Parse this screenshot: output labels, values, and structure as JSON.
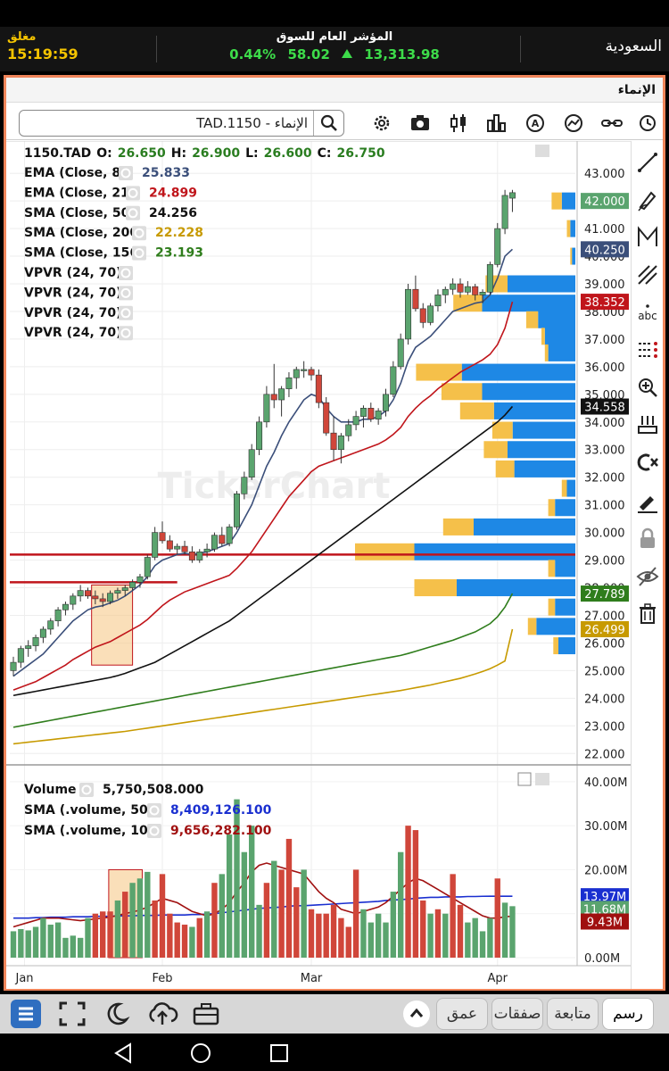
{
  "market": {
    "status_label": "مغلق",
    "time": "15:19:59",
    "index_title": "المؤشر العام للسوق",
    "change_pct": "0.44%",
    "change_pts": "58.02",
    "index_value": "13,313.98",
    "country": "السعودية"
  },
  "panel": {
    "title": "الإنماء"
  },
  "search": {
    "value": "TAD.1150 - الإنماء"
  },
  "ohlc": {
    "symbol": "1150.TAD",
    "o_label": "O:",
    "o": "26.650",
    "h_label": "H:",
    "h": "26.900",
    "l_label": "L:",
    "l": "26.600",
    "c_label": "C:",
    "c": "26.750"
  },
  "indicators": [
    {
      "label": "EMA (Close, 8)",
      "value": "25.833",
      "color": "#3b4f7a"
    },
    {
      "label": "EMA (Close, 21)",
      "value": "24.899",
      "color": "#c0151b"
    },
    {
      "label": "SMA (Close, 50)",
      "value": "24.256",
      "color": "#111111"
    },
    {
      "label": "SMA (Close, 200)",
      "value": "22.228",
      "color": "#c79a00"
    },
    {
      "label": "SMA (Close, 156)",
      "value": "23.193",
      "color": "#2f7d1c"
    },
    {
      "label": "VPVR (24, 70)",
      "value": ""
    },
    {
      "label": "VPVR (24, 70)",
      "value": ""
    },
    {
      "label": "VPVR (24, 70)",
      "value": ""
    },
    {
      "label": "VPVR (24, 70)",
      "value": ""
    }
  ],
  "volume_panel": {
    "label": "Volume",
    "value": "5,750,508.000",
    "sma50_label": "SMA (.volume, 50)",
    "sma50_value": "8,409,126.100",
    "sma10_label": "SMA (.volume, 10)",
    "sma10_value": "9,656,282.100"
  },
  "price_badges": [
    {
      "text": "42.000",
      "color": "#5aa46e"
    },
    {
      "text": "40.250",
      "color": "#3b4f7a"
    },
    {
      "text": "38.352",
      "color": "#c0151b"
    },
    {
      "text": "34.558",
      "color": "#111111"
    },
    {
      "text": "27.789",
      "color": "#2f7d1c"
    },
    {
      "text": "26.499",
      "color": "#c79a00"
    }
  ],
  "volume_badges": [
    {
      "text": "13.97M",
      "color": "#1a2fd0"
    },
    {
      "text": "11.68M",
      "color": "#5aa46e"
    },
    {
      "text": "9.43M",
      "color": "#a01010"
    }
  ],
  "watermark": "TickerChart",
  "tabs": {
    "chart": "رسم",
    "watch": "متابعة",
    "trades": "صفقات",
    "depth": "عمق"
  },
  "chart_data": {
    "type": "candlestick",
    "y_ticks": [
      "43.000",
      "42.000",
      "41.000",
      "40.000",
      "39.000",
      "38.000",
      "37.000",
      "36.000",
      "35.000",
      "34.000",
      "33.000",
      "32.000",
      "31.000",
      "30.000",
      "29.000",
      "28.000",
      "27.000",
      "26.000",
      "25.000",
      "24.000",
      "23.000",
      "22.000"
    ],
    "ylim": [
      21.75,
      43.2
    ],
    "x_labels": [
      {
        "text": "Jan",
        "bar": 1.5
      },
      {
        "text": "Feb",
        "bar": 20
      },
      {
        "text": "Mar",
        "bar": 40
      },
      {
        "text": "Apr",
        "bar": 65
      }
    ],
    "candles": [
      [
        25.0,
        25.5,
        24.8,
        25.3
      ],
      [
        25.3,
        25.9,
        25.1,
        25.8
      ],
      [
        25.8,
        26.1,
        25.5,
        25.9
      ],
      [
        25.9,
        26.3,
        25.7,
        26.2
      ],
      [
        26.2,
        26.6,
        26.0,
        26.5
      ],
      [
        26.5,
        26.9,
        26.3,
        26.8
      ],
      [
        26.8,
        27.3,
        26.6,
        27.2
      ],
      [
        27.2,
        27.5,
        27.0,
        27.4
      ],
      [
        27.4,
        27.8,
        27.2,
        27.7
      ],
      [
        27.7,
        28.1,
        27.5,
        27.9
      ],
      [
        27.9,
        28.0,
        27.6,
        27.7
      ],
      [
        27.7,
        27.9,
        27.4,
        27.6
      ],
      [
        27.6,
        27.8,
        27.3,
        27.5
      ],
      [
        27.5,
        27.9,
        27.4,
        27.8
      ],
      [
        27.8,
        28.0,
        27.6,
        27.9
      ],
      [
        27.9,
        28.1,
        27.7,
        28.0
      ],
      [
        28.0,
        28.3,
        27.9,
        28.2
      ],
      [
        28.2,
        28.5,
        28.0,
        28.4
      ],
      [
        28.4,
        29.2,
        28.3,
        29.1
      ],
      [
        29.1,
        30.2,
        29.0,
        30.0
      ],
      [
        30.0,
        30.4,
        29.6,
        29.7
      ],
      [
        29.7,
        29.9,
        29.3,
        29.4
      ],
      [
        29.4,
        29.6,
        29.2,
        29.5
      ],
      [
        29.5,
        29.7,
        29.2,
        29.3
      ],
      [
        29.3,
        29.5,
        28.9,
        29.0
      ],
      [
        29.0,
        29.4,
        28.9,
        29.3
      ],
      [
        29.3,
        29.6,
        29.1,
        29.4
      ],
      [
        29.4,
        30.0,
        29.3,
        29.9
      ],
      [
        29.9,
        30.2,
        29.5,
        29.6
      ],
      [
        29.6,
        30.3,
        29.5,
        30.2
      ],
      [
        30.2,
        31.5,
        30.1,
        31.4
      ],
      [
        31.4,
        32.2,
        31.2,
        32.0
      ],
      [
        32.0,
        33.2,
        31.9,
        33.0
      ],
      [
        33.0,
        34.2,
        32.8,
        34.0
      ],
      [
        34.0,
        35.3,
        33.8,
        35.0
      ],
      [
        35.0,
        36.1,
        34.5,
        34.8
      ],
      [
        34.8,
        35.3,
        34.2,
        35.2
      ],
      [
        35.2,
        35.8,
        34.9,
        35.6
      ],
      [
        35.6,
        36.0,
        35.2,
        35.9
      ],
      [
        35.9,
        36.2,
        35.6,
        35.9
      ],
      [
        35.9,
        36.0,
        35.5,
        35.7
      ],
      [
        35.7,
        35.9,
        34.5,
        34.7
      ],
      [
        34.7,
        34.9,
        33.5,
        33.6
      ],
      [
        33.6,
        34.2,
        32.6,
        33.0
      ],
      [
        33.0,
        33.6,
        32.5,
        33.5
      ],
      [
        33.5,
        34.1,
        33.3,
        33.9
      ],
      [
        33.9,
        34.4,
        33.7,
        34.2
      ],
      [
        34.2,
        34.6,
        33.8,
        34.5
      ],
      [
        34.5,
        34.7,
        34.0,
        34.1
      ],
      [
        34.1,
        34.5,
        33.9,
        34.4
      ],
      [
        34.4,
        35.2,
        34.2,
        35.0
      ],
      [
        35.0,
        36.2,
        34.9,
        36.0
      ],
      [
        36.0,
        37.2,
        35.9,
        37.0
      ],
      [
        37.0,
        39.0,
        36.8,
        38.8
      ],
      [
        38.8,
        39.3,
        38.0,
        38.1
      ],
      [
        38.1,
        38.3,
        37.4,
        37.6
      ],
      [
        37.6,
        38.3,
        37.5,
        38.2
      ],
      [
        38.2,
        38.8,
        38.0,
        38.6
      ],
      [
        38.6,
        38.9,
        38.3,
        38.8
      ],
      [
        38.8,
        39.2,
        38.6,
        39.0
      ],
      [
        39.0,
        39.2,
        38.5,
        38.7
      ],
      [
        38.7,
        39.1,
        38.6,
        38.9
      ],
      [
        38.9,
        39.0,
        38.4,
        38.6
      ],
      [
        38.6,
        38.8,
        38.3,
        38.7
      ],
      [
        38.7,
        39.8,
        38.6,
        39.7
      ],
      [
        39.7,
        41.2,
        39.6,
        41.0
      ],
      [
        41.0,
        42.4,
        40.8,
        42.2
      ],
      [
        42.1,
        42.4,
        41.6,
        42.3
      ]
    ],
    "ema8": [
      24.8,
      25.0,
      25.2,
      25.4,
      25.6,
      25.9,
      26.2,
      26.5,
      26.8,
      27.0,
      27.2,
      27.3,
      27.35,
      27.45,
      27.55,
      27.7,
      27.9,
      28.1,
      28.4,
      28.8,
      29.0,
      29.1,
      29.2,
      29.25,
      29.2,
      29.25,
      29.3,
      29.4,
      29.5,
      29.6,
      30.0,
      30.5,
      31.0,
      31.7,
      32.4,
      32.9,
      33.5,
      34.0,
      34.4,
      34.8,
      35.0,
      34.9,
      34.5,
      34.2,
      34.0,
      34.0,
      34.0,
      34.1,
      34.1,
      34.2,
      34.4,
      34.8,
      35.4,
      36.2,
      36.7,
      36.9,
      37.1,
      37.4,
      37.7,
      38.0,
      38.1,
      38.2,
      38.3,
      38.35,
      38.6,
      39.2,
      40.0,
      40.25
    ],
    "ema21": [
      24.3,
      24.4,
      24.5,
      24.6,
      24.75,
      24.9,
      25.05,
      25.2,
      25.4,
      25.55,
      25.7,
      25.85,
      25.95,
      26.05,
      26.2,
      26.35,
      26.5,
      26.65,
      26.85,
      27.1,
      27.35,
      27.55,
      27.7,
      27.85,
      27.95,
      28.05,
      28.15,
      28.25,
      28.35,
      28.45,
      28.7,
      29.0,
      29.3,
      29.7,
      30.1,
      30.5,
      30.9,
      31.3,
      31.6,
      31.9,
      32.2,
      32.4,
      32.5,
      32.6,
      32.7,
      32.8,
      32.9,
      33.0,
      33.1,
      33.2,
      33.35,
      33.55,
      33.8,
      34.2,
      34.5,
      34.75,
      34.95,
      35.2,
      35.4,
      35.6,
      35.8,
      35.95,
      36.1,
      36.25,
      36.45,
      36.8,
      37.4,
      38.35
    ],
    "sma50": [
      24.1,
      24.15,
      24.2,
      24.25,
      24.3,
      24.35,
      24.4,
      24.45,
      24.5,
      24.55,
      24.6,
      24.65,
      24.7,
      24.75,
      24.82,
      24.9,
      25.0,
      25.1,
      25.2,
      25.3,
      25.45,
      25.6,
      25.75,
      25.9,
      26.05,
      26.2,
      26.35,
      26.5,
      26.65,
      26.8,
      27.0,
      27.2,
      27.4,
      27.6,
      27.8,
      28.0,
      28.2,
      28.4,
      28.6,
      28.8,
      29.0,
      29.2,
      29.4,
      29.6,
      29.8,
      30.0,
      30.2,
      30.4,
      30.6,
      30.8,
      31.0,
      31.2,
      31.4,
      31.6,
      31.8,
      32.0,
      32.2,
      32.4,
      32.6,
      32.8,
      33.0,
      33.2,
      33.4,
      33.6,
      33.8,
      34.0,
      34.25,
      34.56
    ],
    "sma156": [
      22.95,
      23.0,
      23.05,
      23.1,
      23.15,
      23.2,
      23.25,
      23.3,
      23.35,
      23.4,
      23.45,
      23.5,
      23.55,
      23.6,
      23.65,
      23.7,
      23.75,
      23.8,
      23.85,
      23.9,
      23.95,
      24.0,
      24.05,
      24.1,
      24.15,
      24.2,
      24.25,
      24.3,
      24.35,
      24.4,
      24.45,
      24.5,
      24.55,
      24.6,
      24.65,
      24.7,
      24.75,
      24.8,
      24.85,
      24.9,
      24.95,
      25.0,
      25.05,
      25.1,
      25.15,
      25.2,
      25.25,
      25.3,
      25.35,
      25.4,
      25.45,
      25.5,
      25.55,
      25.62,
      25.7,
      25.78,
      25.86,
      25.94,
      26.02,
      26.1,
      26.2,
      26.3,
      26.4,
      26.55,
      26.7,
      26.95,
      27.3,
      27.79
    ],
    "sma200": [
      22.35,
      22.38,
      22.41,
      22.44,
      22.47,
      22.5,
      22.53,
      22.56,
      22.59,
      22.62,
      22.65,
      22.68,
      22.71,
      22.74,
      22.77,
      22.8,
      22.84,
      22.88,
      22.92,
      22.96,
      23.0,
      23.04,
      23.08,
      23.12,
      23.16,
      23.2,
      23.24,
      23.28,
      23.32,
      23.36,
      23.4,
      23.44,
      23.48,
      23.52,
      23.56,
      23.6,
      23.64,
      23.68,
      23.72,
      23.76,
      23.8,
      23.84,
      23.88,
      23.92,
      23.96,
      24.0,
      24.04,
      24.08,
      24.12,
      24.16,
      24.2,
      24.24,
      24.28,
      24.33,
      24.38,
      24.43,
      24.48,
      24.54,
      24.6,
      24.66,
      24.72,
      24.8,
      24.88,
      24.97,
      25.07,
      25.2,
      25.35,
      26.5
    ],
    "vpvr": [
      [
        42,
        6,
        8
      ],
      [
        41,
        2,
        3
      ],
      [
        40,
        1,
        2
      ],
      [
        39,
        13,
        40
      ],
      [
        38.3,
        17,
        55
      ],
      [
        37.7,
        7,
        22
      ],
      [
        37.1,
        2,
        18
      ],
      [
        36.5,
        2,
        16
      ],
      [
        35.8,
        27,
        67
      ],
      [
        35.1,
        24,
        55
      ],
      [
        34.4,
        20,
        48
      ],
      [
        33.7,
        12,
        37
      ],
      [
        33.0,
        14,
        40
      ],
      [
        32.3,
        11,
        36
      ],
      [
        31.6,
        3,
        5
      ],
      [
        30.9,
        4,
        12
      ],
      [
        30.2,
        18,
        60
      ],
      [
        29.3,
        35,
        95
      ],
      [
        28.7,
        4,
        12
      ],
      [
        28.0,
        25,
        70
      ],
      [
        27.3,
        4,
        12
      ],
      [
        26.6,
        5,
        23
      ],
      [
        25.9,
        3,
        10
      ]
    ],
    "volume": [
      6,
      6.5,
      6.2,
      7,
      9,
      7.5,
      8,
      4.5,
      5,
      4.5,
      9,
      10,
      10.5,
      10.5,
      13,
      15,
      17,
      18,
      19.5,
      13,
      19,
      10,
      8,
      7.5,
      7,
      9,
      10.5,
      17,
      19,
      28,
      36,
      24,
      30,
      12,
      17,
      22,
      20,
      27,
      16,
      20,
      11,
      10,
      10,
      12,
      9,
      7,
      20,
      11,
      8,
      10,
      8,
      15,
      24,
      30,
      29,
      13,
      10,
      11,
      10,
      19,
      12,
      8,
      9,
      6,
      9,
      18,
      12.5,
      11.7
    ],
    "vol_colors": "GGGGGGGGGGGRRRGRGGGRRRRRGRGRGGGGGGRGRRRGRRRRRRRGGGGGGRRRGRGRRGGGGRGG",
    "vol_sma50": [
      9,
      9,
      9,
      9.1,
      9.1,
      9.2,
      9.2,
      9.2,
      9.3,
      9.3,
      9.3,
      9.4,
      9.4,
      9.4,
      9.5,
      9.5,
      9.5,
      9.6,
      9.6,
      9.6,
      9.7,
      9.7,
      9.7,
      9.7,
      9.8,
      9.8,
      9.9,
      10,
      10.2,
      10.4,
      10.6,
      10.8,
      11,
      11.2,
      11.3,
      11.4,
      11.5,
      11.7,
      11.8,
      11.8,
      11.9,
      12,
      12.1,
      12.2,
      12.3,
      12.4,
      12.5,
      12.6,
      12.7,
      12.8,
      13,
      13.1,
      13.2,
      13.3,
      13.5,
      13.6,
      13.7,
      13.7,
      13.8,
      13.8,
      13.8,
      13.9,
      13.9,
      13.95,
      13.97,
      13.97,
      13.97,
      13.97
    ],
    "vol_sma10": [
      7,
      7.5,
      8,
      8.5,
      9,
      9,
      9,
      8.8,
      8.6,
      8.4,
      8.6,
      8.8,
      9,
      9.2,
      9.6,
      10,
      10.4,
      10.8,
      11.5,
      12.5,
      13.5,
      13,
      12.5,
      11.5,
      10.5,
      10,
      9.5,
      10,
      11,
      12.5,
      15,
      17,
      19.5,
      21,
      21.5,
      21,
      20.5,
      20,
      19.5,
      19,
      17,
      15,
      13.5,
      12.5,
      11,
      10.5,
      10,
      10.5,
      11,
      11.5,
      12.5,
      14,
      15.5,
      17,
      18,
      17.5,
      16.5,
      15.5,
      14.5,
      13.5,
      12.5,
      11.5,
      10.5,
      9.5,
      9,
      9,
      9.3,
      9.43
    ],
    "vol_ticks": [
      "40.00M",
      "30.00M",
      "20.00M",
      "10.00M",
      "0.00M"
    ],
    "h_lines": [
      29.2,
      28.2
    ]
  }
}
